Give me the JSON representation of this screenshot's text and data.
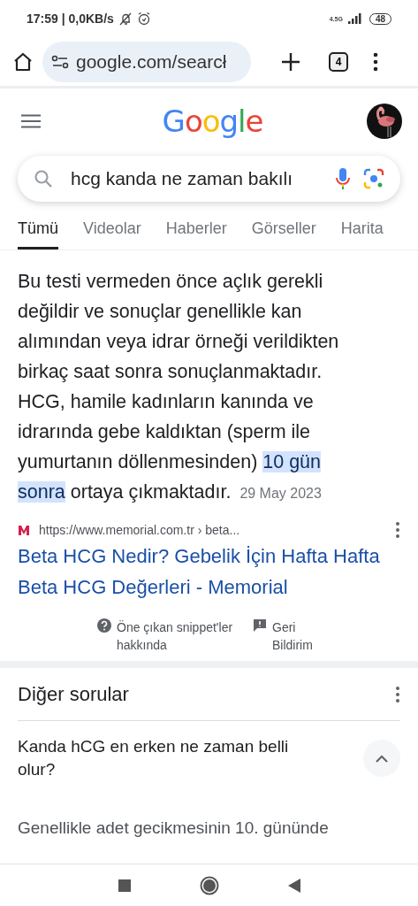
{
  "status_bar": {
    "time": "17:59 | 0,0KB/s",
    "network": "4.5G",
    "battery": "48"
  },
  "browser": {
    "url": "google.com/searcł",
    "tab_count": "4"
  },
  "header": {
    "logo": "Google"
  },
  "search": {
    "value": "hcg kanda ne zaman bakılı"
  },
  "tabs": [
    {
      "label": "Tümü",
      "selected": true
    },
    {
      "label": "Videolar",
      "selected": false
    },
    {
      "label": "Haberler",
      "selected": false
    },
    {
      "label": "Görseller",
      "selected": false
    },
    {
      "label": "Harita",
      "selected": false
    }
  ],
  "snippet": {
    "text": "Bu testi vermeden önce açlık gerekli değildir ve sonuçlar genellikle kan alımından veya idrar örneği verildikten birkaç saat sonra sonuçlanmaktadır. HCG, hamile kadınların kanında ve idrarında gebe kaldıktan (sperm ile yumurtanın döllenmesinden) **10 gün sonra** ortaya çıkmaktadır.",
    "date": "29 May 2023",
    "source_url": "https://www.memorial.com.tr › beta...",
    "title": "Beta HCG Nedir? Gebelik İçin Hafta Hafta Beta HCG Değerleri - Memorial",
    "about": "Öne çıkan snippet'ler hakkında",
    "feedback": "Geri Bildirim"
  },
  "related": {
    "heading": "Diğer sorular",
    "questions": [
      {
        "text": "Kanda hCG en erken ne zaman belli olur?",
        "expanded": true,
        "answer": "Genellikle adet gecikmesinin 10. gününde"
      }
    ]
  }
}
